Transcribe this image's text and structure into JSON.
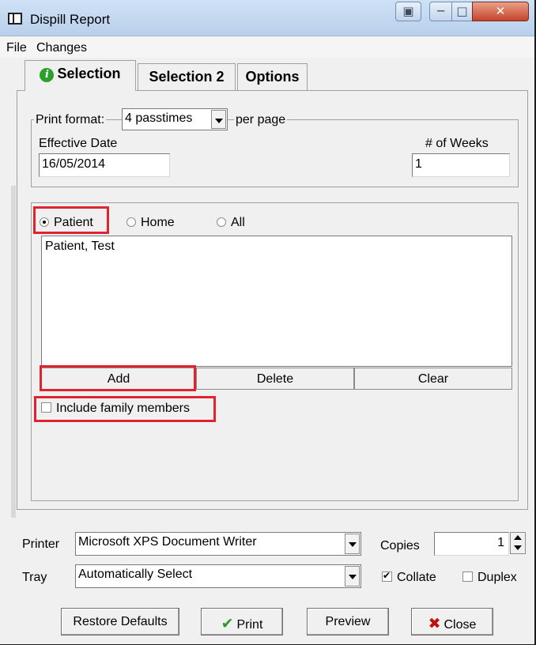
{
  "window": {
    "title": "Dispill Report"
  },
  "menu": [
    "File",
    "Changes"
  ],
  "tabs": [
    "Selection",
    "Selection 2",
    "Options"
  ],
  "print_format": {
    "legend_prefix": "Print format:",
    "value": "4 passtimes",
    "legend_suffix": "per page"
  },
  "effective_date": {
    "label": "Effective Date",
    "value": "16/05/2014"
  },
  "weeks": {
    "label": "# of Weeks",
    "value": "1"
  },
  "selection_mode": {
    "options": [
      "Patient",
      "Home",
      "All"
    ],
    "selected": "Patient"
  },
  "selected_items": [
    "Patient, Test"
  ],
  "list_buttons": {
    "add": "Add",
    "delete": "Delete",
    "clear": "Clear"
  },
  "include_family": {
    "label": "Include family members",
    "checked": false
  },
  "printer": {
    "label": "Printer",
    "value": "Microsoft XPS Document Writer"
  },
  "copies": {
    "label": "Copies",
    "value": "1"
  },
  "tray": {
    "label": "Tray",
    "value": "Automatically Select"
  },
  "collate": {
    "label": "Collate",
    "checked": true
  },
  "duplex": {
    "label": "Duplex",
    "checked": false
  },
  "buttons": {
    "restore": "Restore Defaults",
    "print": "Print",
    "preview": "Preview",
    "close": "Close"
  },
  "highlight_color": "#e0232e"
}
